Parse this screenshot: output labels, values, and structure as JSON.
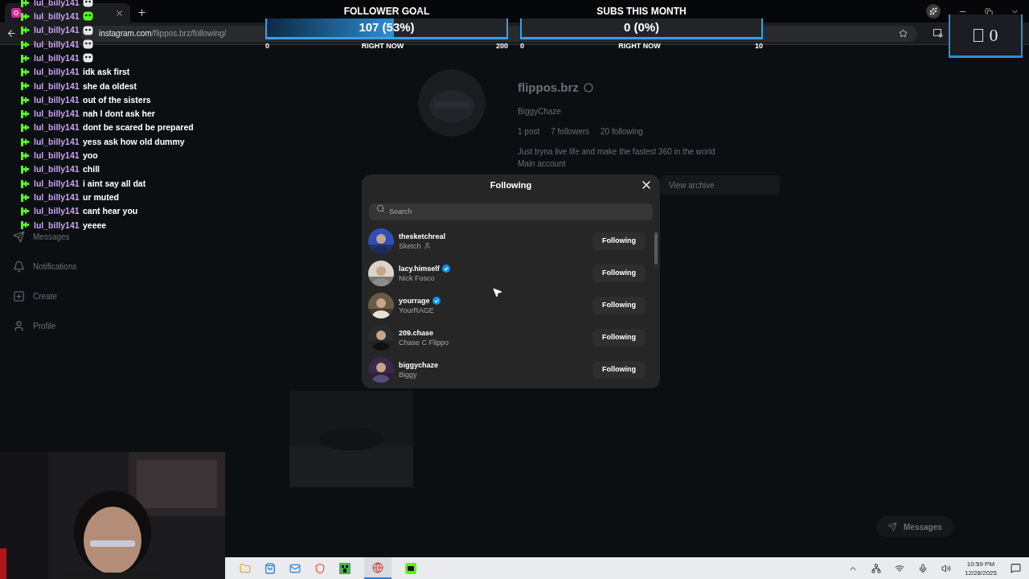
{
  "browser": {
    "url_host": "instagram.com",
    "url_path": "/flippos.brz/following/"
  },
  "sidebar": {
    "items": [
      {
        "label": "Messages"
      },
      {
        "label": "Notifications"
      },
      {
        "label": "Create"
      },
      {
        "label": "Profile"
      }
    ]
  },
  "profile": {
    "username": "flippos.brz",
    "full_name": "BiggyChaze",
    "stats": [
      "1 post",
      "7 followers",
      "20 following"
    ],
    "bio": "Just tryna live life and make the fastest 360 in the world",
    "bio_line2": "Main account",
    "archive_button": "View archive",
    "messages_button": "Messages"
  },
  "modal": {
    "title": "Following",
    "search_placeholder": "Search",
    "users": [
      {
        "username": "thesketchreal",
        "name": "Sketch",
        "verified": false,
        "person_icon": true,
        "button": "Following"
      },
      {
        "username": "lacy.himself",
        "name": "Nick Fosco",
        "verified": true,
        "person_icon": false,
        "button": "Following"
      },
      {
        "username": "yourrage",
        "name": "YourRAGE",
        "verified": true,
        "person_icon": false,
        "button": "Following"
      },
      {
        "username": "209.chase",
        "name": "Chase C Flippo",
        "verified": false,
        "person_icon": false,
        "button": "Following"
      },
      {
        "username": "biggychaze",
        "name": "Biggy",
        "verified": false,
        "person_icon": false,
        "button": "Following"
      }
    ]
  },
  "goals": [
    {
      "title": "FOLLOWER GOAL",
      "value": "107 (53%)",
      "level": 0.53,
      "min": "0",
      "caption": "RIGHT NOW",
      "max": "200"
    },
    {
      "title": "SUBS THIS MONTH",
      "value": "0 (0%)",
      "level": 0,
      "min": "0",
      "caption": "RIGHT NOW",
      "max": "10"
    }
  ],
  "chat": [
    {
      "user": "lul_billy141",
      "kind": "emote",
      "color": "#e6e6e6"
    },
    {
      "user": "lul_billy141",
      "kind": "emote",
      "color": "#53fc18"
    },
    {
      "user": "lul_billy141",
      "kind": "emote",
      "color": "#e6e6e6"
    },
    {
      "user": "lul_billy141",
      "kind": "emote",
      "color": "#e6e6e6"
    },
    {
      "user": "lul_billy141",
      "kind": "emote",
      "color": "#e6e6e6"
    },
    {
      "user": "lul_billy141",
      "kind": "text",
      "text": "idk ask first"
    },
    {
      "user": "lul_billy141",
      "kind": "text",
      "text": "she da oldest"
    },
    {
      "user": "lul_billy141",
      "kind": "text",
      "text": "out of the sisters"
    },
    {
      "user": "lul_billy141",
      "kind": "text",
      "text": "nah I dont ask her"
    },
    {
      "user": "lul_billy141",
      "kind": "text",
      "text": "dont be scared be prepared"
    },
    {
      "user": "lul_billy141",
      "kind": "text",
      "text": "yess ask how old dummy"
    },
    {
      "user": "lul_billy141",
      "kind": "text",
      "text": "yoo"
    },
    {
      "user": "lul_billy141",
      "kind": "text",
      "text": "chill"
    },
    {
      "user": "lul_billy141",
      "kind": "text",
      "text": "i aint say all dat"
    },
    {
      "user": "lul_billy141",
      "kind": "text",
      "text": "ur muted"
    },
    {
      "user": "lul_billy141",
      "kind": "text",
      "text": "cant hear you"
    },
    {
      "user": "lul_billy141",
      "kind": "text",
      "text": "yeeee"
    }
  ],
  "counter": {
    "value": "0"
  },
  "taskbar": {
    "time": "10:59 PM",
    "date": "12/28/2025"
  }
}
